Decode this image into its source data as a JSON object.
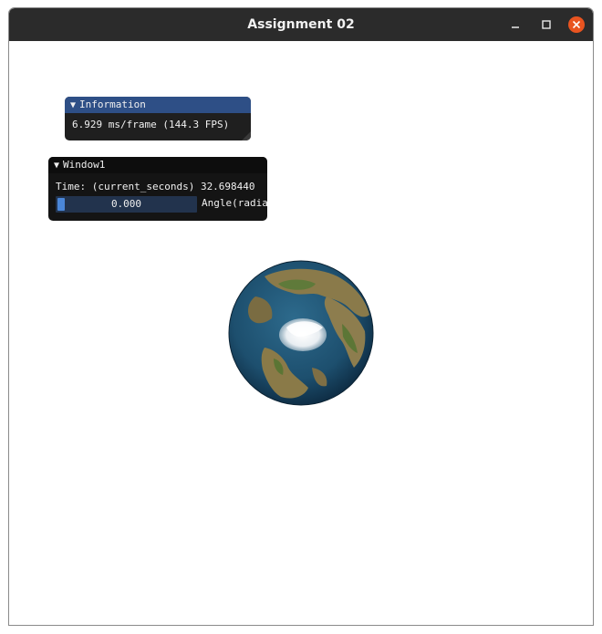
{
  "window": {
    "title": "Assignment 02"
  },
  "info_panel": {
    "header": "Information",
    "fps_text": "6.929 ms/frame (144.3 FPS)"
  },
  "window1": {
    "header": "Window1",
    "time_text": "Time: (current_seconds) 32.698440",
    "slider_value": "0.000",
    "slider_label": "Angle(radians)"
  },
  "colors": {
    "titlebar": "#2b2b2b",
    "close_button": "#e95420",
    "info_header": "#2e4f86",
    "slider_bg": "#22334d",
    "slider_grab": "#4a86d8"
  },
  "icons": [
    "minimize-icon",
    "maximize-icon",
    "close-icon",
    "collapse-arrow-icon",
    "earth-globe"
  ]
}
